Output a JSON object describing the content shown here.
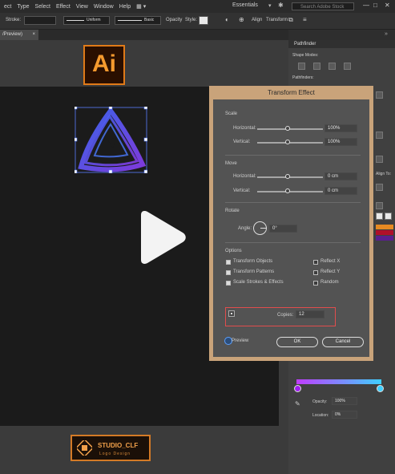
{
  "menu": {
    "items": [
      "ect",
      "Type",
      "Select",
      "Effect",
      "View",
      "Window",
      "Help"
    ],
    "workspace": "Essentials",
    "search_placeholder": "Search Adobe Stock"
  },
  "control_bar": {
    "stroke_label": "Stroke:",
    "stroke_profile": "Uniform",
    "brush": "Basic",
    "opacity_label": "Opacity",
    "style_label": "Style:",
    "align_label": "Align",
    "transform_label": "Transform"
  },
  "document_tab": {
    "label": "/Preview)"
  },
  "logo_overlay": {
    "text": "Ai",
    "accent": "#e07a18"
  },
  "studio_badge": {
    "name": "STUDIO_CLF",
    "tagline": "Logo Design"
  },
  "right_panel": {
    "header": "Pathfinder",
    "shape_modes": "Shape Modes:",
    "pathfinders": "Pathfinders:",
    "align_label": "Align To:",
    "opacity_label": "Opacity:",
    "opacity_value": "100%",
    "location_label": "Location:",
    "location_value": "0%"
  },
  "dialog": {
    "title": "Transform Effect",
    "scale": {
      "label": "Scale",
      "horizontal_label": "Horizontal:",
      "horizontal_value": "100%",
      "vertical_label": "Vertical:",
      "vertical_value": "100%"
    },
    "move": {
      "label": "Move",
      "horizontal_label": "Horizontal:",
      "horizontal_value": "0 cm",
      "vertical_label": "Vertical:",
      "vertical_value": "0 cm"
    },
    "rotate": {
      "label": "Rotate",
      "angle_label": "Angle:",
      "angle_value": "0°"
    },
    "options": {
      "label": "Options",
      "transform_objects": "Transform Objects",
      "transform_patterns": "Transform Patterns",
      "scale_strokes": "Scale Strokes & Effects",
      "reflect_x": "Reflect X",
      "reflect_y": "Reflect Y",
      "random": "Random"
    },
    "copies_label": "Copies:",
    "copies_value": "12",
    "preview_label": "Preview",
    "ok_label": "OK",
    "cancel_label": "Cancel"
  }
}
